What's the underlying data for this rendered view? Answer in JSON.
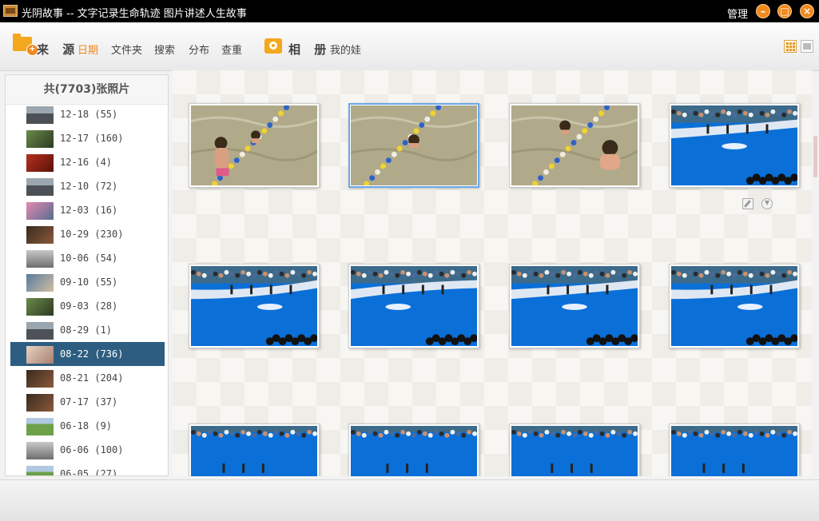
{
  "titlebar": {
    "title": "光阴故事 -- 文字记录生命轨迹 图片讲述人生故事",
    "manage_label": "管理",
    "minimize_symbol": "–",
    "restore_symbol": "□",
    "close_symbol": "×"
  },
  "toolbar": {
    "source_heading": "来 源",
    "source_links": [
      "日期",
      "文件夹",
      "搜索",
      "分布",
      "查重"
    ],
    "active_link": "日期",
    "album_heading": "相 册",
    "album_links": [
      "我的娃"
    ],
    "accent_color": "#f08a1c"
  },
  "sidebar": {
    "header": "共(7703)张照片",
    "items": [
      {
        "label": "12-18 (55)",
        "thumb": "street",
        "selected": false
      },
      {
        "label": "12-17 (160)",
        "thumb": "plant",
        "selected": false
      },
      {
        "label": "12-16 (4)",
        "thumb": "red",
        "selected": false
      },
      {
        "label": "12-10 (72)",
        "thumb": "street",
        "selected": false
      },
      {
        "label": "12-03 (16)",
        "thumb": "pink",
        "selected": false
      },
      {
        "label": "10-29 (230)",
        "thumb": "dark",
        "selected": false
      },
      {
        "label": "10-06 (54)",
        "thumb": "gray",
        "selected": false
      },
      {
        "label": "09-10 (55)",
        "thumb": "crowd",
        "selected": false
      },
      {
        "label": "09-03 (28)",
        "thumb": "plant",
        "selected": false
      },
      {
        "label": "08-29 (1)",
        "thumb": "street",
        "selected": false
      },
      {
        "label": "08-22 (736)",
        "thumb": "beige",
        "selected": true
      },
      {
        "label": "08-21 (204)",
        "thumb": "dark",
        "selected": false
      },
      {
        "label": "07-17 (37)",
        "thumb": "dark",
        "selected": false
      },
      {
        "label": "06-18 (9)",
        "thumb": "grass",
        "selected": false
      },
      {
        "label": "06-06 (100)",
        "thumb": "gray",
        "selected": false
      },
      {
        "label": "06-05 (27)",
        "thumb": "grass",
        "selected": false
      }
    ]
  },
  "photos": [
    {
      "scene": "kid-water-1",
      "selected": false
    },
    {
      "scene": "kid-water-2",
      "selected": true
    },
    {
      "scene": "kid-water-3",
      "selected": false
    },
    {
      "scene": "dolphin-show-1",
      "selected": false,
      "hover_actions": true
    },
    {
      "scene": "dolphin-show-2",
      "selected": false
    },
    {
      "scene": "dolphin-show-3",
      "selected": false
    },
    {
      "scene": "dolphin-show-4",
      "selected": false
    },
    {
      "scene": "dolphin-show-5",
      "selected": false
    },
    {
      "scene": "dolphin-show-6",
      "selected": false
    },
    {
      "scene": "dolphin-show-7",
      "selected": false
    },
    {
      "scene": "dolphin-show-8",
      "selected": false
    },
    {
      "scene": "dolphin-show-9",
      "selected": false
    }
  ],
  "icons": [
    "app-icon",
    "folder-add-icon",
    "camera-icon",
    "grid-view-icon",
    "single-view-icon",
    "edit-icon",
    "download-icon"
  ]
}
